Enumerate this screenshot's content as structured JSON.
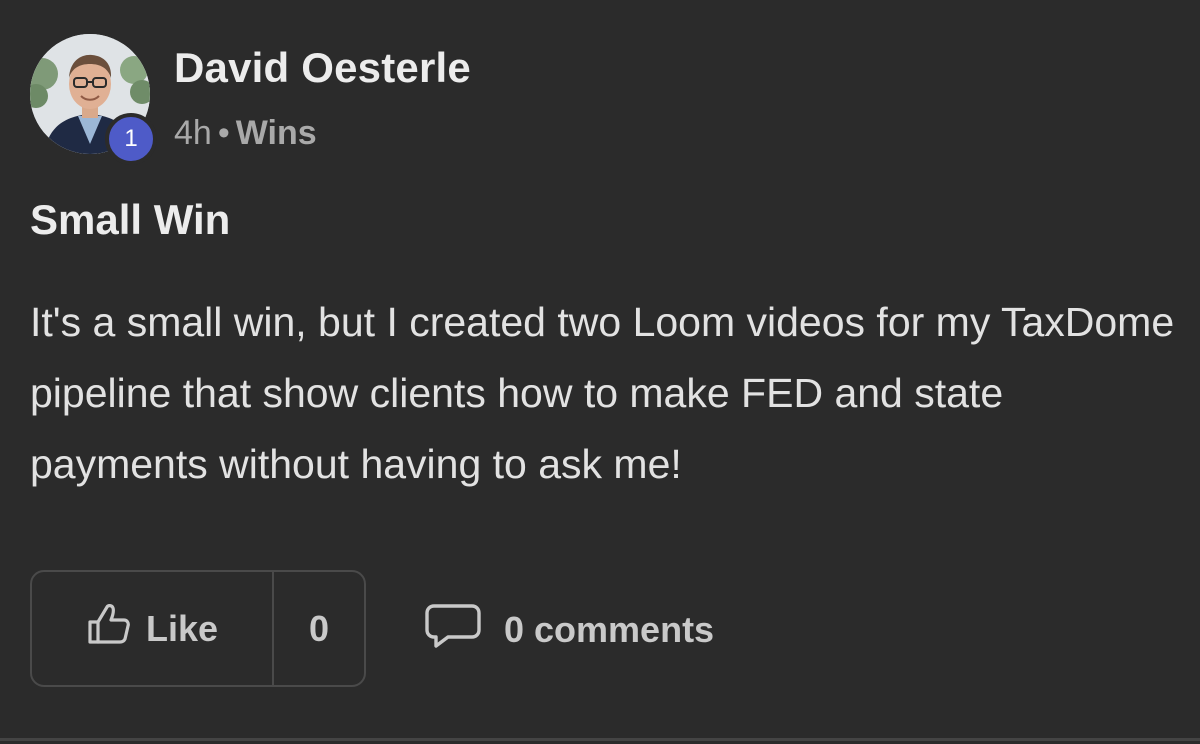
{
  "post": {
    "author": {
      "name": "David Oesterle",
      "level": "1"
    },
    "meta": {
      "time": "4h",
      "separator": "•",
      "category": "Wins"
    },
    "title": "Small Win",
    "body": "It's a small win, but I created two Loom videos for my TaxDome pipeline that show clients how to make FED and state payments without having to ask me!",
    "actions": {
      "like_label": "Like",
      "like_count": "0",
      "comments_label": "0 comments"
    }
  },
  "icons": {
    "like": "thumbs-up-icon",
    "comment": "comment-bubble-icon"
  },
  "colors": {
    "background": "#2b2b2b",
    "level_badge": "#4e5bc8",
    "text_primary": "#ececec",
    "text_secondary": "#a9a9a9"
  }
}
